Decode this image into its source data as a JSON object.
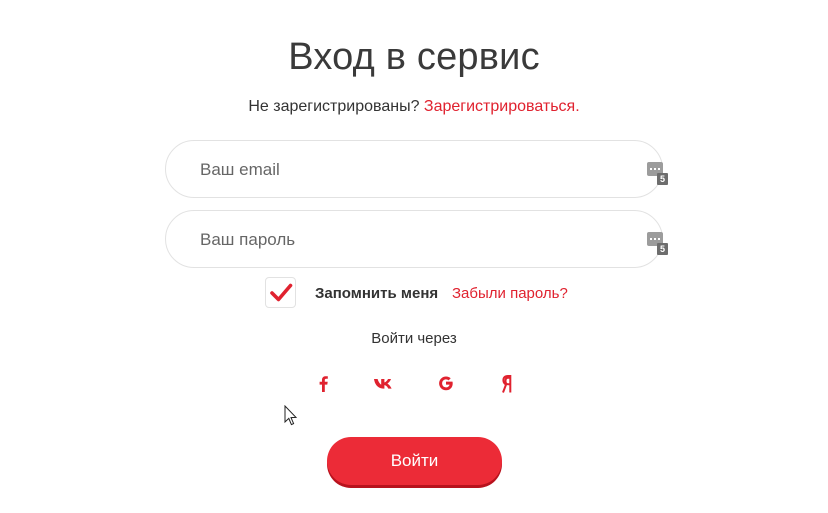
{
  "page": {
    "title": "Вход в сервис",
    "subtitle_text": "Не зарегистрированы?",
    "register_link": "Зарегистрироваться."
  },
  "form": {
    "email_placeholder": "Ваш email",
    "password_placeholder": "Ваш пароль",
    "email_value": "",
    "password_value": "",
    "password_manager_badge": "5",
    "remember_label": "Запомнить меня",
    "remember_checked": true,
    "forgot_link": "Забыли пароль?",
    "submit_label": "Войти"
  },
  "social": {
    "heading": "Войти через",
    "providers": [
      {
        "name": "facebook",
        "icon": "facebook-icon"
      },
      {
        "name": "vk",
        "icon": "vk-icon"
      },
      {
        "name": "google",
        "icon": "google-icon"
      },
      {
        "name": "yandex",
        "icon": "yandex-icon"
      }
    ]
  },
  "colors": {
    "accent": "#e0222f",
    "button": "#ec2b37",
    "button_shadow": "#b8121d",
    "border": "#e2e2e2"
  }
}
